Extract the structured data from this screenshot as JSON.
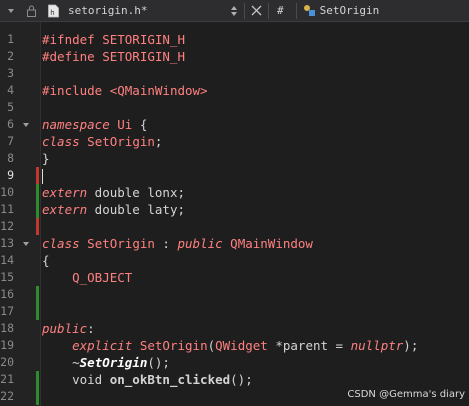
{
  "toolbar": {
    "filename": "setorigin.h*",
    "hash": "#",
    "symbol": "SetOrigin"
  },
  "colors": {
    "background": "#1e1e1e",
    "modified_marker": "#c0392b",
    "saved_marker": "#2e8b2e",
    "keyword": "#ff8080"
  },
  "lines": [
    {
      "n": "1",
      "marker": "",
      "fold": "",
      "tokens": [
        [
          "pp",
          "#ifndef SETORIGIN_H"
        ]
      ]
    },
    {
      "n": "2",
      "marker": "",
      "fold": "",
      "tokens": [
        [
          "pp",
          "#define SETORIGIN_H"
        ]
      ]
    },
    {
      "n": "3",
      "marker": "",
      "fold": "",
      "tokens": []
    },
    {
      "n": "4",
      "marker": "",
      "fold": "",
      "tokens": [
        [
          "pp",
          "#include "
        ],
        [
          "str",
          "<QMainWindow>"
        ]
      ]
    },
    {
      "n": "5",
      "marker": "",
      "fold": "",
      "tokens": []
    },
    {
      "n": "6",
      "marker": "",
      "fold": "v",
      "tokens": [
        [
          "kw",
          "namespace"
        ],
        [
          "ty",
          " "
        ],
        [
          "fn",
          "Ui"
        ],
        [
          "ty",
          " {"
        ]
      ]
    },
    {
      "n": "7",
      "marker": "",
      "fold": "",
      "tokens": [
        [
          "kw",
          "class"
        ],
        [
          "ty",
          " "
        ],
        [
          "fn",
          "SetOrigin"
        ],
        [
          "ty",
          ";"
        ]
      ]
    },
    {
      "n": "8",
      "marker": "",
      "fold": "",
      "tokens": [
        [
          "ty",
          "}"
        ]
      ]
    },
    {
      "n": "9",
      "marker": "red",
      "fold": "",
      "current": true,
      "cursor": true,
      "tokens": []
    },
    {
      "n": "10",
      "marker": "green",
      "fold": "",
      "tokens": [
        [
          "kw",
          "extern"
        ],
        [
          "ty",
          " double lonx;"
        ]
      ]
    },
    {
      "n": "11",
      "marker": "green",
      "fold": "",
      "tokens": [
        [
          "kw",
          "extern"
        ],
        [
          "ty",
          " double laty;"
        ]
      ]
    },
    {
      "n": "12",
      "marker": "red",
      "fold": "",
      "tokens": []
    },
    {
      "n": "13",
      "marker": "",
      "fold": "v",
      "tokens": [
        [
          "kw",
          "class"
        ],
        [
          "ty",
          " "
        ],
        [
          "fn",
          "SetOrigin"
        ],
        [
          "ty",
          " : "
        ],
        [
          "kw",
          "public"
        ],
        [
          "ty",
          " "
        ],
        [
          "fn",
          "QMainWindow"
        ]
      ]
    },
    {
      "n": "14",
      "marker": "",
      "fold": "",
      "tokens": [
        [
          "ty",
          "{"
        ]
      ]
    },
    {
      "n": "15",
      "marker": "",
      "fold": "",
      "tokens": [
        [
          "ty",
          "    "
        ],
        [
          "macro",
          "Q_OBJECT"
        ]
      ]
    },
    {
      "n": "16",
      "marker": "green",
      "fold": "",
      "tokens": []
    },
    {
      "n": "17",
      "marker": "green",
      "fold": "",
      "tokens": []
    },
    {
      "n": "18",
      "marker": "",
      "fold": "",
      "tokens": [
        [
          "kw",
          "public"
        ],
        [
          "ty",
          ":"
        ]
      ]
    },
    {
      "n": "19",
      "marker": "",
      "fold": "",
      "tokens": [
        [
          "ty",
          "    "
        ],
        [
          "kw",
          "explicit"
        ],
        [
          "ty",
          " "
        ],
        [
          "fn",
          "SetOrigin"
        ],
        [
          "ty",
          "("
        ],
        [
          "fn",
          "QWidget"
        ],
        [
          "ty",
          " *parent = "
        ],
        [
          "kw",
          "nullptr"
        ],
        [
          "ty",
          ");"
        ]
      ]
    },
    {
      "n": "20",
      "marker": "",
      "fold": "",
      "tokens": [
        [
          "ty",
          "    ~"
        ],
        [
          "fni",
          "SetOrigin"
        ],
        [
          "ty",
          "();"
        ]
      ]
    },
    {
      "n": "21",
      "marker": "green",
      "fold": "",
      "tokens": [
        [
          "ty",
          "    void "
        ],
        [
          "bold",
          "on_okBtn_clicked"
        ],
        [
          "ty",
          "();"
        ]
      ]
    },
    {
      "n": "22",
      "marker": "green",
      "fold": "",
      "tokens": []
    }
  ],
  "watermark": "CSDN @Gemma's diary"
}
